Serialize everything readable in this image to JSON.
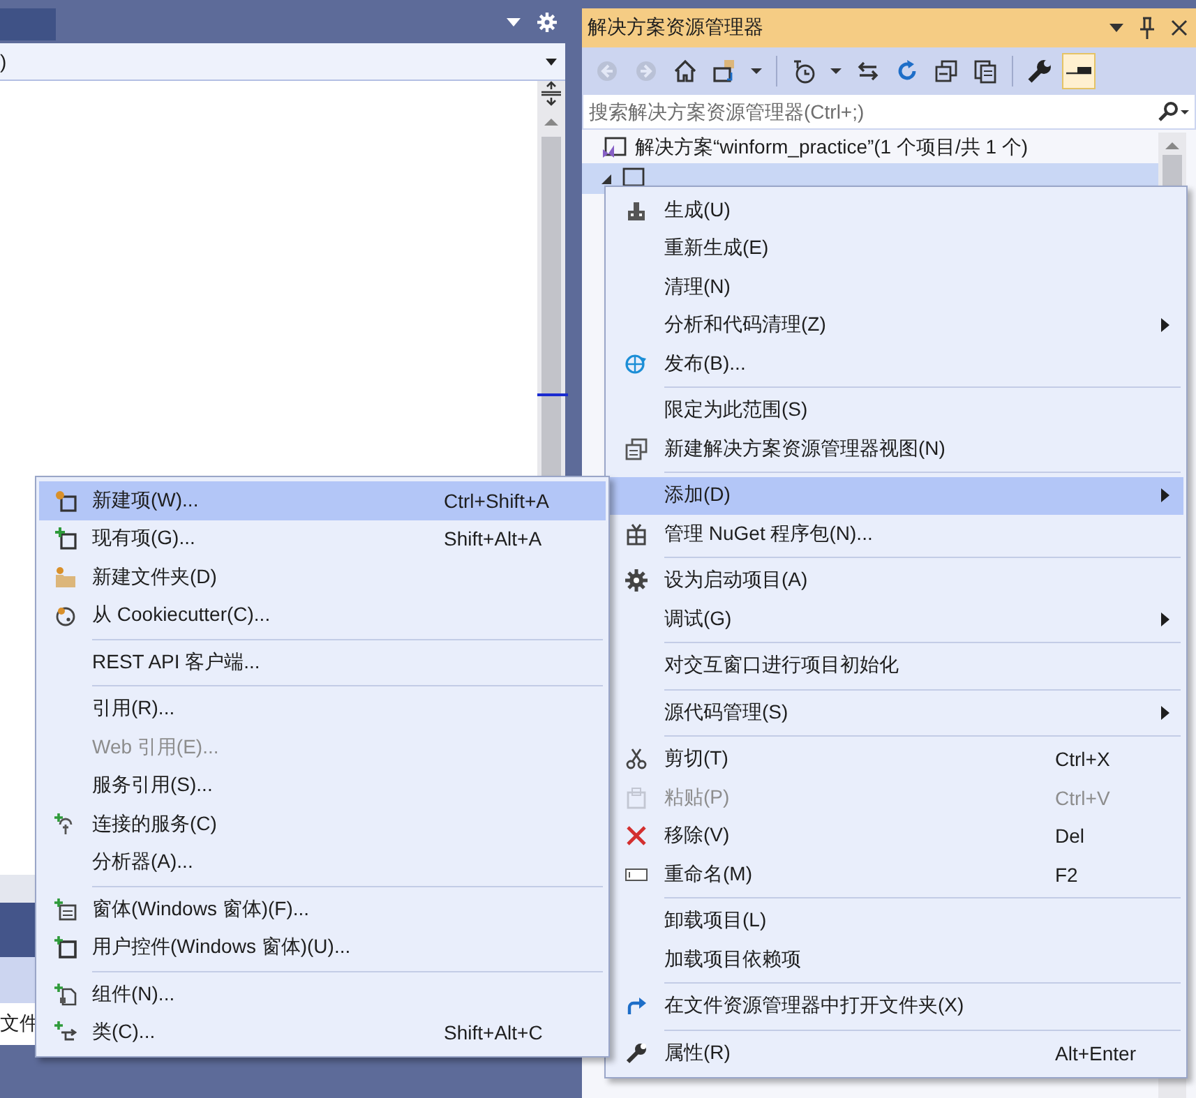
{
  "left_panel": {
    "dropdown_value": ")",
    "bottom_label": "文件"
  },
  "solution_explorer": {
    "title": "解决方案资源管理器",
    "toolbar": [
      {
        "kind": "back",
        "disabled": true
      },
      {
        "kind": "forward",
        "disabled": true
      },
      {
        "kind": "home"
      },
      {
        "kind": "switch-views"
      },
      {
        "kind": "caret"
      },
      {
        "kind": "divider"
      },
      {
        "kind": "history"
      },
      {
        "kind": "caret"
      },
      {
        "kind": "sync"
      },
      {
        "kind": "refresh"
      },
      {
        "kind": "collapse"
      },
      {
        "kind": "copy"
      },
      {
        "kind": "divider"
      },
      {
        "kind": "wrench"
      },
      {
        "kind": "preview",
        "pressed": true
      }
    ],
    "search": {
      "placeholder": "搜索解决方案资源管理器(Ctrl+;)"
    },
    "tree": [
      {
        "label": "解决方案“winform_practice”(1 个项目/共 1 个)",
        "selected": false
      },
      {
        "selected": true,
        "expanded": true
      }
    ]
  },
  "context_menu": [
    {
      "kind": "item",
      "label": "生成(U)"
    },
    {
      "kind": "item",
      "label": "重新生成(E)"
    },
    {
      "kind": "item",
      "label": "清理(N)"
    },
    {
      "kind": "item",
      "label": "分析和代码清理(Z)",
      "submenu": true
    },
    {
      "kind": "item",
      "label": "发布(B)..."
    },
    {
      "kind": "separator"
    },
    {
      "kind": "item",
      "label": "限定为此范围(S)"
    },
    {
      "kind": "item",
      "label": "新建解决方案资源管理器视图(N)"
    },
    {
      "kind": "separator"
    },
    {
      "kind": "item",
      "label": "添加(D)",
      "submenu": true,
      "selected": true
    },
    {
      "kind": "item",
      "label": "管理 NuGet 程序包(N)..."
    },
    {
      "kind": "separator"
    },
    {
      "kind": "item",
      "label": "设为启动项目(A)"
    },
    {
      "kind": "item",
      "label": "调试(G)",
      "submenu": true
    },
    {
      "kind": "separator"
    },
    {
      "kind": "item",
      "label": "对交互窗口进行项目初始化"
    },
    {
      "kind": "separator"
    },
    {
      "kind": "item",
      "label": "源代码管理(S)",
      "submenu": true
    },
    {
      "kind": "separator"
    },
    {
      "kind": "item",
      "label": "剪切(T)",
      "shortcut": "Ctrl+X"
    },
    {
      "kind": "item",
      "label": "粘贴(P)",
      "shortcut": "Ctrl+V",
      "disabled": true
    },
    {
      "kind": "item",
      "label": "移除(V)",
      "shortcut": "Del"
    },
    {
      "kind": "item",
      "label": "重命名(M)",
      "shortcut": "F2"
    },
    {
      "kind": "separator"
    },
    {
      "kind": "item",
      "label": "卸载项目(L)"
    },
    {
      "kind": "item",
      "label": "加载项目依赖项"
    },
    {
      "kind": "separator"
    },
    {
      "kind": "item",
      "label": "在文件资源管理器中打开文件夹(X)"
    },
    {
      "kind": "separator"
    },
    {
      "kind": "item",
      "label": "属性(R)",
      "shortcut": "Alt+Enter"
    }
  ],
  "add_submenu": [
    {
      "kind": "item",
      "label": "新建项(W)...",
      "shortcut": "Ctrl+Shift+A",
      "selected": true
    },
    {
      "kind": "item",
      "label": "现有项(G)...",
      "shortcut": "Shift+Alt+A"
    },
    {
      "kind": "item",
      "label": "新建文件夹(D)"
    },
    {
      "kind": "item",
      "label": "从 Cookiecutter(C)..."
    },
    {
      "kind": "separator"
    },
    {
      "kind": "item",
      "label": "REST API 客户端..."
    },
    {
      "kind": "separator"
    },
    {
      "kind": "item",
      "label": "引用(R)..."
    },
    {
      "kind": "item",
      "label": "Web 引用(E)...",
      "disabled": true
    },
    {
      "kind": "item",
      "label": "服务引用(S)..."
    },
    {
      "kind": "item",
      "label": "连接的服务(C)"
    },
    {
      "kind": "item",
      "label": "分析器(A)..."
    },
    {
      "kind": "separator"
    },
    {
      "kind": "item",
      "label": "窗体(Windows 窗体)(F)..."
    },
    {
      "kind": "item",
      "label": "用户控件(Windows 窗体)(U)..."
    },
    {
      "kind": "separator"
    },
    {
      "kind": "item",
      "label": "组件(N)..."
    },
    {
      "kind": "item",
      "label": "类(C)...",
      "shortcut": "Shift+Alt+C"
    }
  ]
}
